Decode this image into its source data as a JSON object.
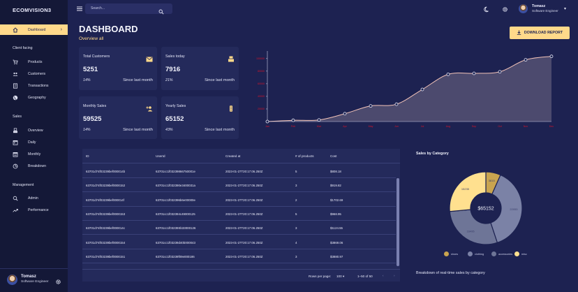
{
  "app": {
    "brand": "ECOMVISION3"
  },
  "sidebar": {
    "dashboard_label": "Dashboard",
    "sections": {
      "client": "Client facing",
      "sales": "Sales",
      "management": "Management"
    },
    "items": {
      "products": "Products",
      "customers": "Customers",
      "transactions": "Transactions",
      "geography": "Geography",
      "overview": "Overview",
      "daily": "Daily",
      "monthly": "Monthly",
      "breakdown": "Breakdown",
      "admin": "Admin",
      "performance": "Performance"
    },
    "user": {
      "name": "Tomasz",
      "role": "Software Engineer"
    }
  },
  "topbar": {
    "search_placeholder": "Search...",
    "user": {
      "name": "Tomasz",
      "role": "Software Engineer"
    }
  },
  "header": {
    "title": "DASHBOARD",
    "subtitle": "Overview all",
    "download_label": "DOWNLOAD REPORT"
  },
  "cards": {
    "total_customers": {
      "title": "Total Customers",
      "value": "5251",
      "percent": "14%",
      "since": "Since last month",
      "icon": "email-icon"
    },
    "sales_today": {
      "title": "Sales today",
      "value": "7916",
      "percent": "21%",
      "since": "Since last month",
      "icon": "register-icon"
    },
    "monthly_sales": {
      "title": "Monthly Sales",
      "value": "59525",
      "percent": "14%",
      "since": "Since last month",
      "icon": "add-person-icon"
    },
    "yearly_sales": {
      "title": "Yearly Sales",
      "value": "65152",
      "percent": "43%",
      "since": "Since last month",
      "icon": "traffic-icon"
    }
  },
  "chart_data": [
    {
      "type": "area",
      "categories": [
        "Jan",
        "Feb",
        "Mar",
        "Apr",
        "May",
        "Jun",
        "Jul",
        "Aug",
        "Sep",
        "Oct",
        "Nov",
        "Dec"
      ],
      "series": [
        {
          "values": [
            0,
            2000,
            2500,
            12500,
            24800,
            27500,
            51000,
            75000,
            76500,
            79000,
            98000,
            103500
          ]
        }
      ],
      "ytick_labels": [
        "20000",
        "40000",
        "60000",
        "80000",
        "100000"
      ],
      "ytick_values": [
        20000,
        40000,
        60000,
        80000,
        100000
      ],
      "ylim": [
        0,
        112000
      ],
      "grid": false,
      "line_color": "#f2c3b8",
      "fill_color": "#4c4a6e",
      "tick_color": "#d7142a"
    },
    {
      "type": "pie",
      "title": "Sales by Category",
      "total_label": "$65152",
      "slices": [
        {
          "name": "shoes",
          "value": 3815,
          "color": "#c9a44f"
        },
        {
          "name": "clothing",
          "value": 22053,
          "color": "#7b82a6"
        },
        {
          "name": "accessories",
          "value": 16495,
          "color": "#6e7597"
        },
        {
          "name": "misc",
          "value": 15235,
          "color": "#ffe08f"
        }
      ],
      "slice_order": [
        "shoes",
        "clothing",
        "accessories",
        "misc"
      ],
      "slice_labels": {
        "shoes": "3815",
        "clothing": "22053",
        "accessories": "16495",
        "misc": "15235"
      },
      "caption": "Breakdown of real-time sales by category"
    }
  ],
  "table": {
    "columns": [
      "ID",
      "UserId",
      "Created at",
      "# of products",
      "Cost"
    ],
    "rows": [
      [
        "63701d74f03239bef000014b",
        "63701cc1f03239866750001e",
        "2023-01-27T20:17:06.250Z",
        "5",
        "$808.18"
      ],
      [
        "63701d74f03239bef0000152",
        "63701cc1f032390e3400031a",
        "2023-01-27T20:17:06.250Z",
        "3",
        "$919.82"
      ],
      [
        "63701d74f03239bef000014f",
        "63701cc1f032396b6e00000e",
        "2023-01-27T20:17:06.250Z",
        "2",
        "$1702.69"
      ],
      [
        "63701d74f03239bef0000153",
        "63701cc1f032394c49000125",
        "2023-01-27T20:17:06.250Z",
        "5",
        "$968.95"
      ],
      [
        "63701d74f03239bef000014c",
        "63701cc1f03239Sb33000126",
        "2023-01-27T20:17:06.250Z",
        "3",
        "$1124.55"
      ],
      [
        "63701d74f03239bef0000154",
        "63701cc1f03239d40b000043",
        "2023-01-27T20:17:06.250Z",
        "4",
        "$3869.06"
      ],
      [
        "63701d74f03239bef0000151",
        "63701cc1f03239f09e000186",
        "2023-01-27T20:17:06.250Z",
        "3",
        "$3880.97"
      ]
    ],
    "footer": {
      "rows_per_page_label": "Rows per page:",
      "rows_per_page": "100",
      "range": "1–50 of 50"
    }
  }
}
